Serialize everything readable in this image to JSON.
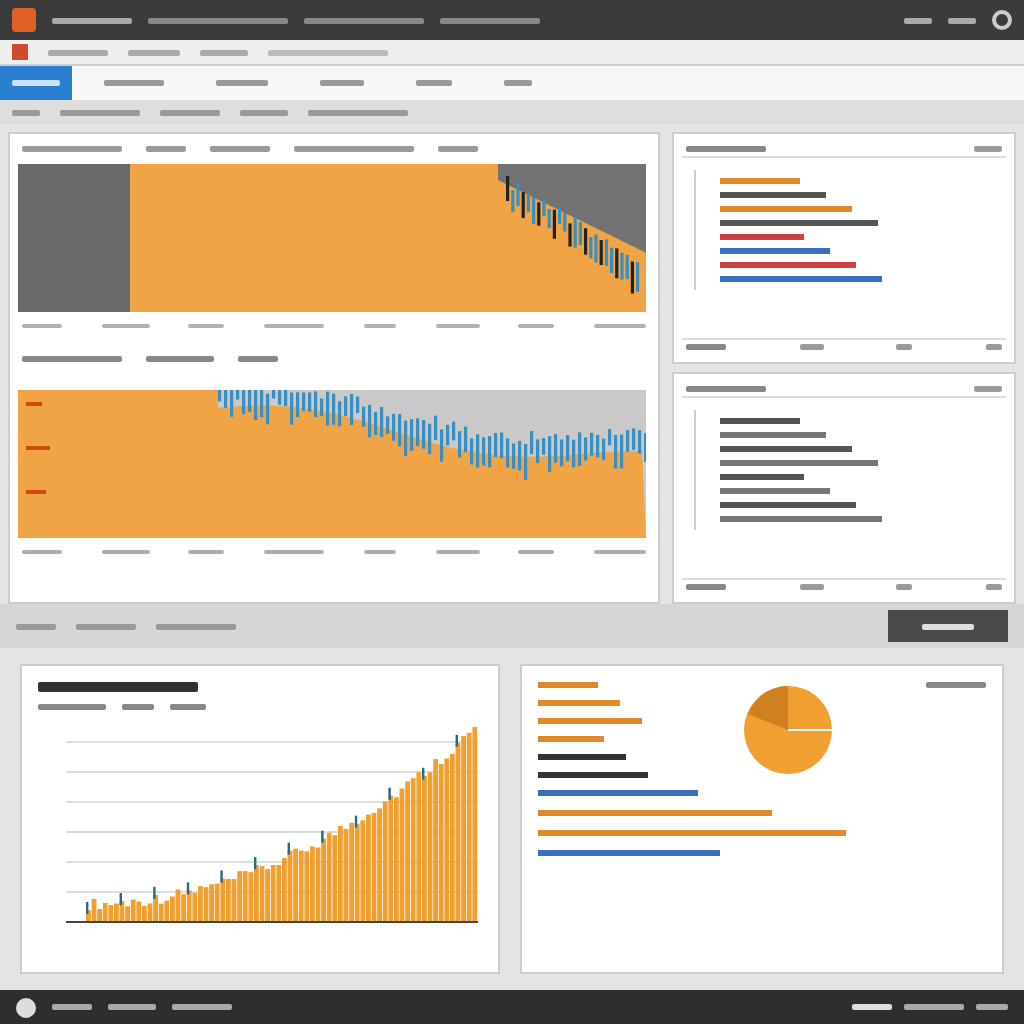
{
  "ribbon_buttons": [
    {
      "selected": true
    },
    {
      "selected": false
    },
    {
      "selected": false
    },
    {
      "selected": false
    },
    {
      "selected": false
    },
    {
      "selected": false
    }
  ],
  "upper_charts": [
    {
      "kind": "falling"
    },
    {
      "kind": "wave"
    }
  ],
  "code_panels": [
    {
      "lines": [
        {
          "color": "#e0892a"
        },
        {
          "color": "#555555"
        },
        {
          "color": "#e0892a"
        },
        {
          "color": "#555555"
        },
        {
          "color": "#d04040"
        },
        {
          "color": "#3a6fc0"
        },
        {
          "color": "#d04040"
        },
        {
          "color": "#3a6fc0"
        }
      ]
    },
    {
      "lines": [
        {
          "color": "#555555"
        },
        {
          "color": "#777777"
        },
        {
          "color": "#555555"
        },
        {
          "color": "#777777"
        },
        {
          "color": "#555555"
        },
        {
          "color": "#777777"
        },
        {
          "color": "#555555"
        },
        {
          "color": "#777777"
        }
      ]
    }
  ],
  "lower_chart": {
    "kind": "rising"
  },
  "summary": {
    "kind": "pie",
    "legend": [
      {
        "color": "#e0892a"
      },
      {
        "color": "#e0892a"
      },
      {
        "color": "#e0892a"
      },
      {
        "color": "#e0892a"
      },
      {
        "color": "#333333"
      },
      {
        "color": "#333333"
      }
    ],
    "notes": [
      {
        "color": "#3a6fc0"
      },
      {
        "color": "#e0892a"
      },
      {
        "color": "#e0892a"
      },
      {
        "color": "#3a6fc0"
      }
    ]
  }
}
